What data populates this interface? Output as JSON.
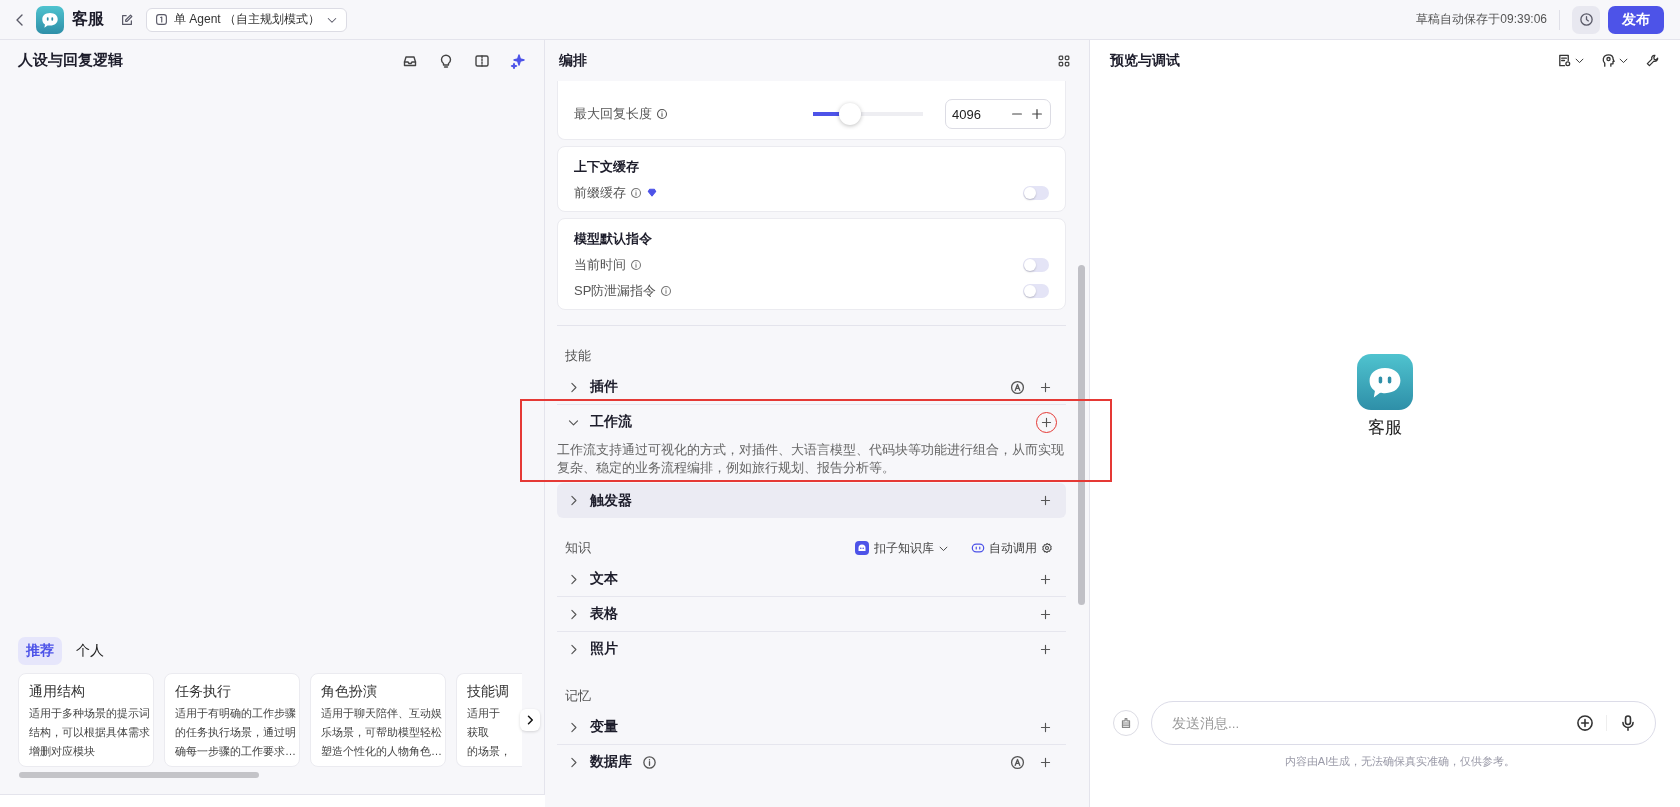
{
  "topbar": {
    "app_name": "客服",
    "mode": "单 Agent （自主规划模式）",
    "autosave": "草稿自动保存于09:39:06",
    "publish": "发布"
  },
  "persona": {
    "title": "人设与回复逻辑",
    "template_tabs": [
      {
        "label": "推荐",
        "selected": true
      },
      {
        "label": "个人",
        "selected": false
      }
    ],
    "templates": [
      {
        "title": "通用结构",
        "lines": [
          "适用于多种场景的提示词",
          "结构，可以根据具体需求",
          "增删对应模块"
        ]
      },
      {
        "title": "任务执行",
        "lines": [
          "适用于有明确的工作步骤",
          "的任务执行场景，通过明",
          "确每一步骤的工作要求…"
        ]
      },
      {
        "title": "角色扮演",
        "lines": [
          "适用于聊天陪伴、互动娱",
          "乐场景，可帮助模型轻松",
          "塑造个性化的人物角色…"
        ]
      },
      {
        "title": "技能调",
        "lines": [
          "适用于",
          "获取",
          "的场景，"
        ]
      }
    ]
  },
  "orchestration": {
    "title": "编排",
    "length_setting": {
      "label": "最大回复长度",
      "level": 0.34,
      "value": "4096"
    },
    "setting_cards": [
      {
        "title": "上下文缓存",
        "settings": [
          {
            "label": "前缀缓存",
            "premium": true,
            "on": false
          }
        ]
      },
      {
        "title": "模型默认指令",
        "settings": [
          {
            "label": "当前时间",
            "on": false
          },
          {
            "label": "SP防泄漏指令",
            "on": false
          }
        ]
      }
    ],
    "groups": [
      {
        "title": "技能",
        "items": [
          {
            "label": "插件",
            "expanded": false,
            "auto": true,
            "info": false,
            "hovered": false,
            "highlighted": false
          },
          {
            "label": "工作流",
            "expanded": true,
            "auto": false,
            "info": false,
            "hovered": false,
            "highlighted": true,
            "description": "工作流支持通过可视化的方式，对插件、大语言模型、代码块等功能进行组合，从而实现复杂、稳定的业务流程编排，例如旅行规划、报告分析等。"
          },
          {
            "label": "触发器",
            "expanded": false,
            "auto": false,
            "info": false,
            "hovered": true,
            "highlighted": false
          }
        ]
      },
      {
        "title": "知识",
        "source": "扣子知识库",
        "mode": "自动调用",
        "items": [
          {
            "label": "文本",
            "expanded": false,
            "auto": false,
            "info": false,
            "hovered": false,
            "highlighted": false
          },
          {
            "label": "表格",
            "expanded": false,
            "auto": false,
            "info": false,
            "hovered": false,
            "highlighted": false
          },
          {
            "label": "照片",
            "expanded": false,
            "auto": false,
            "info": false,
            "hovered": false,
            "highlighted": false
          }
        ]
      },
      {
        "title": "记忆",
        "items": [
          {
            "label": "变量",
            "expanded": false,
            "auto": false,
            "info": false,
            "hovered": false,
            "highlighted": false
          },
          {
            "label": "数据库",
            "expanded": false,
            "auto": true,
            "info": true,
            "hovered": false,
            "highlighted": false
          }
        ]
      }
    ]
  },
  "preview": {
    "title": "预览与调试",
    "bot_name": "客服",
    "input": {
      "placeholder": "发送消息..."
    },
    "disclaimer": "内容由AI生成，无法确保真实准确，仅供参考。"
  }
}
